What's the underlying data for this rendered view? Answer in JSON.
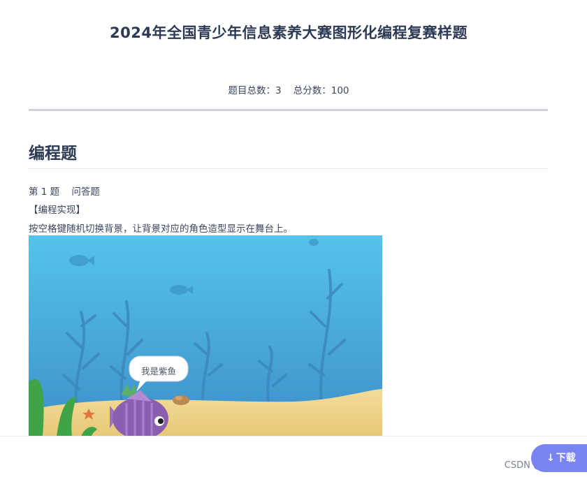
{
  "header": {
    "title": "2024年全国青少年信息素养大赛图形化编程复赛样题",
    "summary": "题目总数：3    总分数：100"
  },
  "section": {
    "title": "编程题"
  },
  "question": {
    "heading": "第 1 题    问答题",
    "tag": "【编程实现】",
    "text": "按空格键随机切换背景，让背景对应的角色造型显示在舞台上。",
    "image": {
      "bubble_text": "我是紫鱼"
    }
  },
  "footer": {
    "download_label": "下载",
    "download_icon": "download-arrow-icon",
    "watermark": "CSDN @@小码农"
  },
  "colors": {
    "accent": "#7a83f2",
    "title": "#2b3a55",
    "water_top": "#49b8e6",
    "water_bottom": "#3f8fc9",
    "sand": "#efd58d",
    "fish": "#8b5fb0"
  }
}
